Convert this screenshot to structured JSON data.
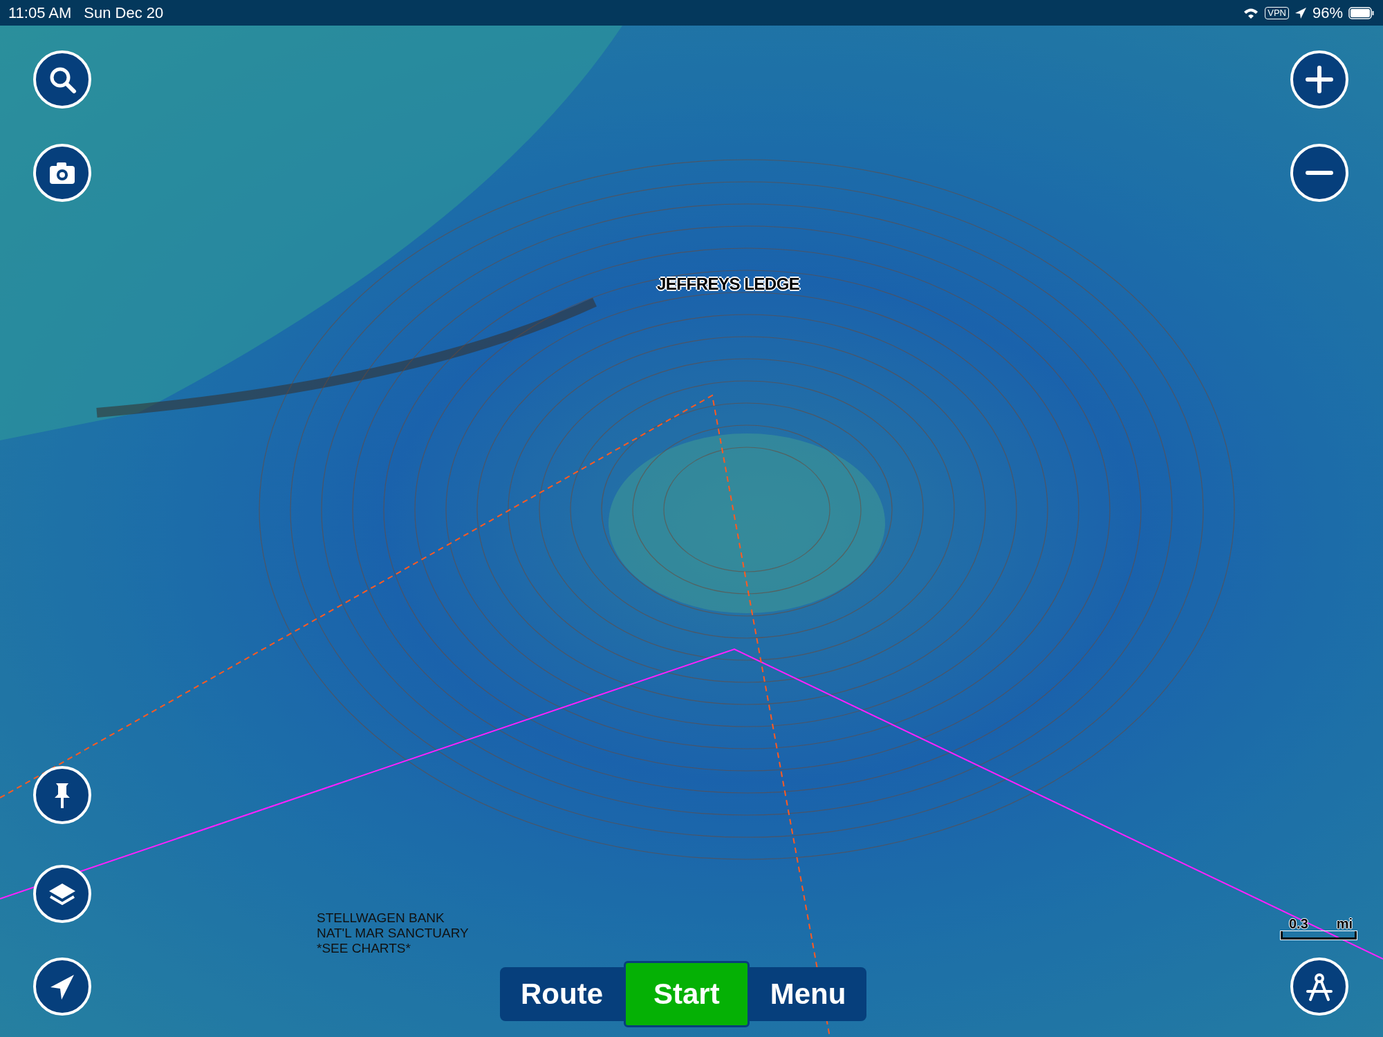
{
  "status_bar": {
    "time": "11:05 AM",
    "date": "Sun Dec 20",
    "vpn": "VPN",
    "battery_percent": "96%"
  },
  "map": {
    "labels": [
      {
        "text": "JEFFREYS LEDGE",
        "kind": "outlined"
      },
      {
        "text": "STELLWAGEN BANK\nNAT'L MAR SANCTUARY\n*SEE CHARTS*",
        "kind": "plain"
      }
    ],
    "scale_bar": {
      "value": "0.3",
      "unit": "mi"
    }
  },
  "bottom_bar": {
    "buttons": [
      {
        "label": "Route",
        "selected": false
      },
      {
        "label": "Start",
        "selected": true
      },
      {
        "label": "Menu",
        "selected": false
      }
    ]
  }
}
